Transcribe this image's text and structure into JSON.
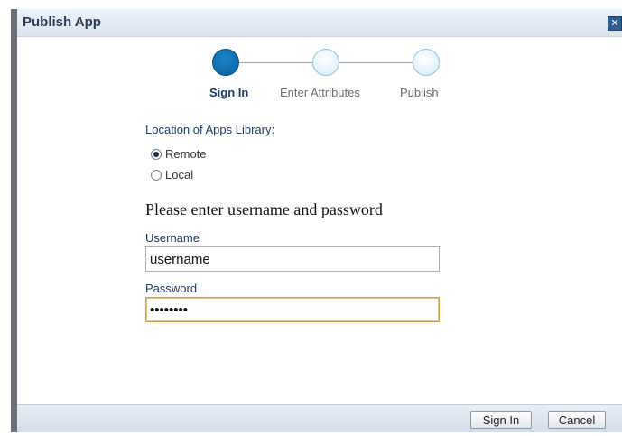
{
  "dialog": {
    "title": "Publish App",
    "close_glyph": "✕"
  },
  "train": {
    "steps": [
      {
        "label": "Sign In",
        "active": true
      },
      {
        "label": "Enter Attributes",
        "active": false
      },
      {
        "label": "Publish",
        "active": false
      }
    ]
  },
  "form": {
    "location_label": "Location of Apps Library:",
    "options": [
      {
        "label": "Remote",
        "checked": true
      },
      {
        "label": "Local",
        "checked": false
      }
    ],
    "prompt": "Please enter username and password",
    "username_label": "Username",
    "username_value": "username",
    "password_label": "Password",
    "password_value": "••••••••"
  },
  "footer": {
    "signin_label": "Sign In",
    "cancel_label": "Cancel"
  },
  "colors": {
    "accent": "#1b3d6d",
    "active_step": "#0a5e97",
    "focus_border": "#d3a24c"
  },
  "icons": [
    "close-icon"
  ]
}
